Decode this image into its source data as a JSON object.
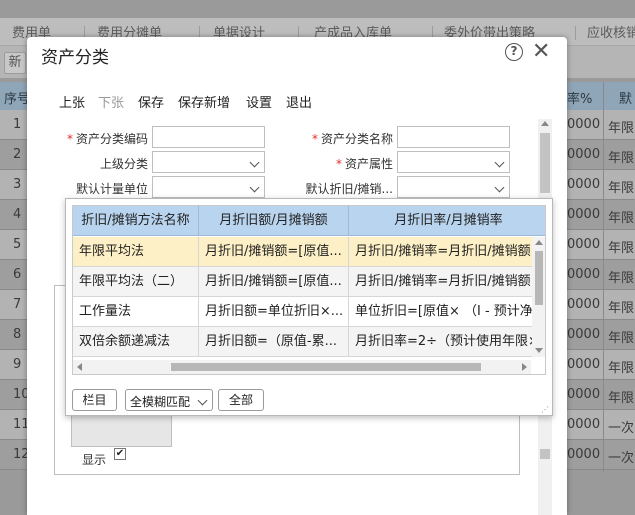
{
  "background": {
    "tabs": [
      "费用单",
      "费用分摊单",
      "单据设计",
      "产成品入库单",
      "委外价带出策略",
      "应收核销"
    ],
    "new_button": "新",
    "header": {
      "seq": "序号",
      "rate": "率%",
      "default": "默"
    },
    "rows": [
      {
        "num": "1",
        "mid": "0000",
        "right": "年限"
      },
      {
        "num": "2",
        "mid": "0000",
        "right": "年限"
      },
      {
        "num": "3",
        "mid": "0000",
        "right": "年限"
      },
      {
        "num": "4",
        "mid": "0000",
        "right": "年限"
      },
      {
        "num": "5",
        "mid": "0000",
        "right": "年限"
      },
      {
        "num": "6",
        "mid": "0000",
        "right": "年限"
      },
      {
        "num": "7",
        "mid": "0000",
        "right": "年限"
      },
      {
        "num": "8",
        "mid": "0000",
        "right": "年限"
      },
      {
        "num": "9",
        "mid": "0000",
        "right": "年限"
      },
      {
        "num": "10",
        "mid": "0000",
        "right": "年限"
      },
      {
        "num": "11",
        "mid": "0000",
        "right": "一次"
      },
      {
        "num": "12",
        "mid": "0000",
        "right": "一次"
      }
    ]
  },
  "dialog": {
    "title": "资产分类",
    "toolbar": {
      "prev": "上张",
      "next": "下张",
      "save": "保存",
      "save_new": "保存新增",
      "settings": "设置",
      "exit": "退出"
    },
    "form": {
      "code_label": "资产分类编码",
      "name_label": "资产分类名称",
      "parent_label": "上级分类",
      "attr_label": "资产属性",
      "unit_label": "默认计量单位",
      "method_label": "默认折旧/摊销...",
      "required_mark": "*",
      "display_label": "显示",
      "display_checked": "✔"
    },
    "popup": {
      "columns": [
        "折旧/摊销方法名称",
        "月折旧额/月摊销额",
        "月折旧率/月摊销率"
      ],
      "rows": [
        [
          "年限平均法",
          "月折旧/摊销额=[原值...",
          "月折旧/摊销率=月折旧/摊销额..."
        ],
        [
          "年限平均法（二）",
          "月折旧/摊销额=[原值...",
          "月折旧/摊销率=月折旧/摊销额..."
        ],
        [
          "工作量法",
          "月折旧额=单位折旧×...",
          "单位折旧=[原值× （I - 预计净残..."
        ],
        [
          "双倍余额递减法",
          "月折旧额=（原值-累...",
          "月折旧率=2÷（预计使用年限×..."
        ]
      ],
      "columns_button": "栏目",
      "match_mode": "全模糊匹配",
      "all_button": "全部"
    }
  },
  "colors": {
    "header_blue": "#b8d4ee",
    "selected_row": "#fdf0c6",
    "required": "#e03030"
  }
}
